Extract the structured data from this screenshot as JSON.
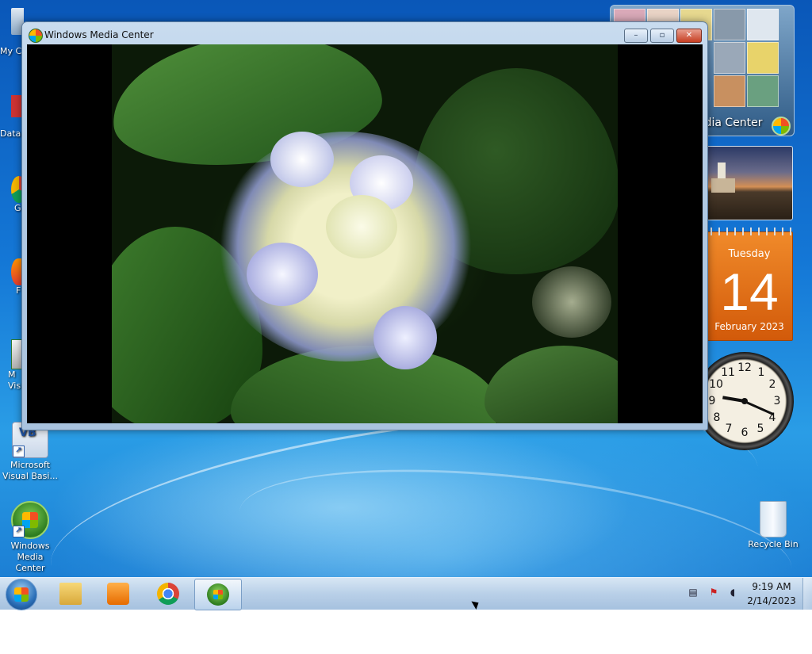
{
  "window": {
    "title": "Windows Media Center",
    "minimize_label": "–",
    "maximize_label": "▫",
    "close_label": "✕"
  },
  "desktop": {
    "icons": [
      {
        "label": "Microsoft Visual Basi...",
        "glyph": "VB"
      },
      {
        "label": "Windows Media Center",
        "glyph": ""
      },
      {
        "label": "Recycle Bin",
        "glyph": ""
      }
    ],
    "edge_labels": [
      "My C",
      "Data",
      "G C",
      "F",
      "M Visu"
    ]
  },
  "gadgets": {
    "media_center_label": "edia Center",
    "calendar": {
      "weekday": "Tuesday",
      "day": "14",
      "month_year": "February 2023"
    },
    "clock": {
      "numerals": [
        "12",
        "1",
        "2",
        "3",
        "4",
        "5",
        "6",
        "7",
        "8",
        "9",
        "10",
        "11"
      ],
      "hour": 9,
      "minute": 19
    }
  },
  "taskbar": {
    "pinned": [
      {
        "name": "start-button",
        "icon": "windows-logo"
      },
      {
        "name": "explorer",
        "icon": "folder-icon"
      },
      {
        "name": "media-player",
        "icon": "media-player-icon"
      },
      {
        "name": "chrome",
        "icon": "chrome-icon"
      },
      {
        "name": "media-center",
        "icon": "media-center-icon",
        "active": true
      }
    ],
    "tray_icons": [
      "network-icon",
      "flag-icon",
      "volume-icon"
    ],
    "time": "9:19 AM",
    "date": "2/14/2023"
  },
  "colors": {
    "accent": "#1477d6",
    "calendar": "#e8731a"
  }
}
